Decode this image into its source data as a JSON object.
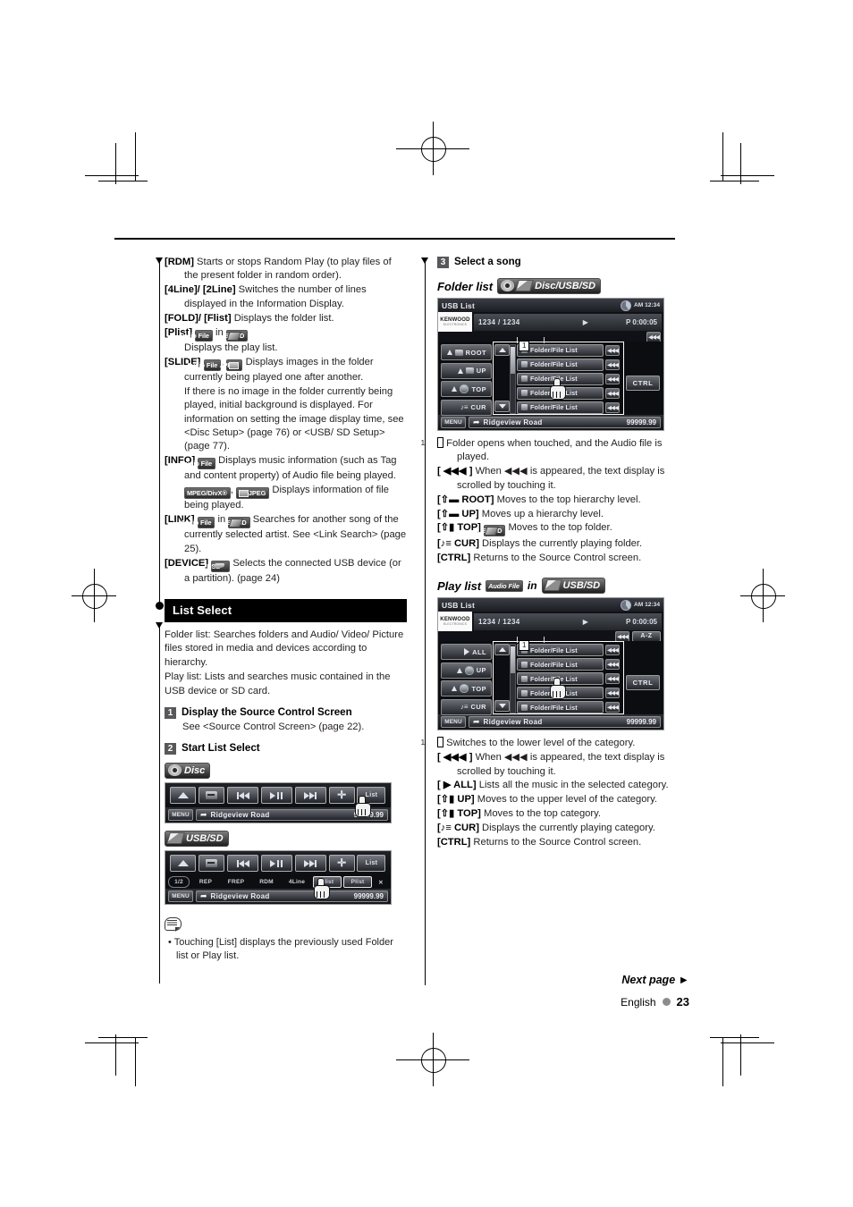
{
  "page": {
    "language": "English",
    "number": "23",
    "next_page": "Next page ►"
  },
  "left_column": {
    "definitions": [
      {
        "key": "[RDM]",
        "text": "Starts or stops Random Play (to play files of the present folder in random order)."
      },
      {
        "key": "[4Line]/ [2Line]",
        "text": "Switches the number of lines displayed in the Information Display."
      },
      {
        "key": "[FOLD]/ [Flist]",
        "text": "Displays the folder list."
      },
      {
        "key": "[Plist]",
        "badges": [
          "Audio File",
          "USB/SD"
        ],
        "connector": "in",
        "text": "Displays the play list."
      },
      {
        "key": "[SLIDE]",
        "badges": [
          "Audio File",
          "JPEG"
        ],
        "text": "Displays images in the folder currently being played one after another."
      },
      {
        "key": "",
        "text": "If there is no image in the folder currently being played, initial background is displayed. For information on setting the image display time, see <Disc Setup> (page 76) or <USB/ SD Setup> (page 77)."
      },
      {
        "key": "[INFO]",
        "badges": [
          "Audio File"
        ],
        "text": "Displays music information (such as Tag and content property) of Audio file being played."
      },
      {
        "key": "",
        "badges": [
          "MPEG/DivX®",
          "JPEG"
        ],
        "text": "Displays information of file being played."
      },
      {
        "key": "[LINK]",
        "badges": [
          "Audio File",
          "USB/SD"
        ],
        "connector": "in",
        "text": "Searches for another song of the currently selected artist. See <Link Search> (page 25)."
      },
      {
        "key": "[DEVICE]",
        "badges": [
          "USB"
        ],
        "text": "Selects the connected USB device (or a partition). (page 24)"
      }
    ],
    "section_title": "List Select",
    "intro_lines": [
      "Folder list: Searches folders and Audio/ Video/ Picture files stored in media and devices according to hierarchy.",
      "Play list: Lists and searches music contained in the USB device or SD card."
    ],
    "step1": {
      "num": "1",
      "title": "Display the Source Control Screen",
      "body": "See <Source Control Screen> (page 22)."
    },
    "step2": {
      "num": "2",
      "title": "Start List Select"
    },
    "note": {
      "bullet": "•",
      "text": "Touching [List] displays the previously used Folder list or Play list."
    },
    "disc_figure": {
      "chip_label": "Disc",
      "buttons": [
        "eject-icon",
        "folder-down-icon",
        "prev-track-icon",
        "play-pause-icon",
        "next-track-icon",
        "folder-up-icon",
        "List"
      ],
      "list_label": "List",
      "menu_label": "MENU",
      "track_title": "Ridgeview Road",
      "track_time": "99999.99"
    },
    "usbsd_figure": {
      "chip_label": "USB/SD",
      "buttons": [
        "eject-icon",
        "folder-down-icon",
        "prev-track-icon",
        "play-pause-icon",
        "next-track-icon",
        "folder-up-icon",
        "List"
      ],
      "list_label": "List",
      "mode_buttons": [
        "1/2",
        "REP",
        "FREP",
        "RDM",
        "4Line",
        "Flist",
        "Plist",
        "✕"
      ],
      "menu_label": "MENU",
      "track_title": "Ridgeview Road",
      "track_time": "99999.99"
    }
  },
  "right_column": {
    "step3": {
      "num": "3",
      "title": "Select a song"
    },
    "folder_list": {
      "heading": "Folder list",
      "chip_label": "Disc/USB/SD",
      "screen": {
        "title": "USB List",
        "clock": "AM 12:34",
        "brand": "KENWOOD",
        "brand_sub": "ELECTRONICS",
        "track_counter": "1234 / 1234",
        "play_marker": "▶",
        "time": "P  0:00:05",
        "side_buttons": [
          "ROOT",
          "UP",
          "TOP",
          "CUR"
        ],
        "list_items": [
          "Folder/File List",
          "Folder/File List",
          "Folder/File List",
          "Folder/File List",
          "Folder/File List"
        ],
        "ctrl_label": "CTRL",
        "menu_label": "MENU",
        "track_title": "Ridgeview Road",
        "track_time": "99999.99",
        "callout": "1"
      },
      "definitions": [
        {
          "key": "1",
          "boxed": true,
          "text": "Folder opens when touched, and the Audio file is played."
        },
        {
          "key": "[ ◀◀◀ ]",
          "text": "When ◀◀◀ is appeared, the text display is scrolled by touching it."
        },
        {
          "key": "[⇧▬ ROOT]",
          "text": "Moves to the top hierarchy level."
        },
        {
          "key": "[⇧▬ UP]",
          "text": "Moves up a hierarchy level."
        },
        {
          "key": "[⇧▮ TOP]",
          "badges": [
            "USB/SD"
          ],
          "text": "Moves to the top folder."
        },
        {
          "key": "[♪≡ CUR]",
          "text": "Displays the currently playing folder."
        },
        {
          "key": "[CTRL]",
          "text": "Returns to the Source Control screen."
        }
      ]
    },
    "play_list": {
      "heading": "Play list",
      "badge_label": "Audio File",
      "connector": "in",
      "chip_label": "USB/SD",
      "screen": {
        "title": "USB List",
        "clock": "AM 12:34",
        "brand": "KENWOOD",
        "brand_sub": "ELECTRONICS",
        "track_counter": "1234 / 1234",
        "play_marker": "▶",
        "time": "P  0:00:05",
        "az_label": "A-Z",
        "side_buttons": [
          "ALL",
          "UP",
          "TOP",
          "CUR"
        ],
        "list_items": [
          "Folder/File List",
          "Folder/File List",
          "Folder/File List",
          "Folder/File List",
          "Folder/File List"
        ],
        "ctrl_label": "CTRL",
        "menu_label": "MENU",
        "track_title": "Ridgeview Road",
        "track_time": "99999.99",
        "callout": "1"
      },
      "definitions": [
        {
          "key": "1",
          "boxed": true,
          "text": "Switches to the lower level of the category."
        },
        {
          "key": "[ ◀◀◀ ]",
          "text": "When ◀◀◀ is appeared, the text display is scrolled by touching it."
        },
        {
          "key": "[ ▶ ALL]",
          "text": "Lists all the music in the selected category."
        },
        {
          "key": "[⇧▮ UP]",
          "text": "Moves to the upper level of the category."
        },
        {
          "key": "[⇧▮ TOP]",
          "text": "Moves to the top category."
        },
        {
          "key": "[♪≡ CUR]",
          "text": "Displays the currently playing category."
        },
        {
          "key": "[CTRL]",
          "text": "Returns to the Source Control screen."
        }
      ]
    }
  }
}
